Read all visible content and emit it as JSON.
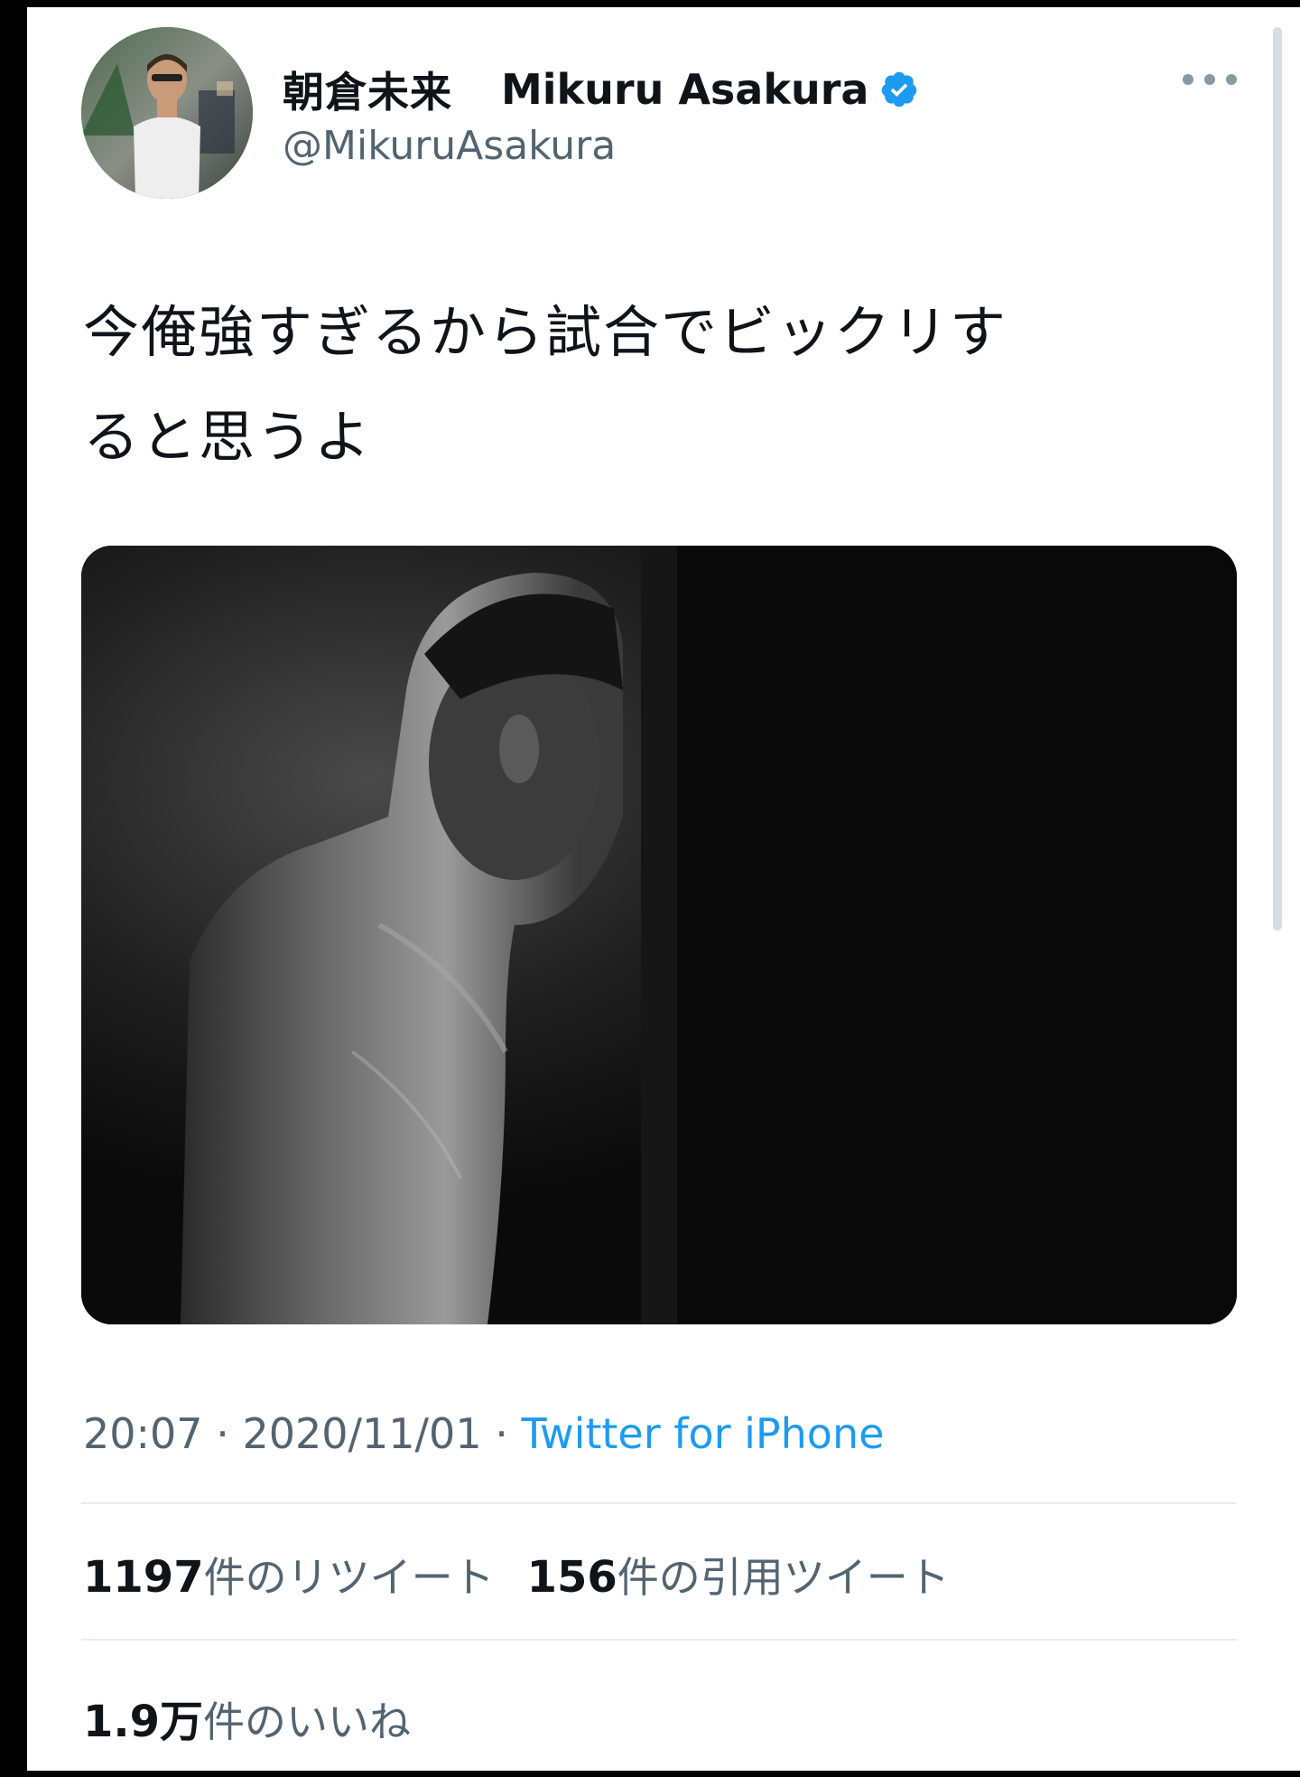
{
  "profile": {
    "display_name_jp": "朝倉未来",
    "display_name_en": "Mikuru Asakura",
    "handle": "@MikuruAsakura",
    "verified_icon": "verified-badge-icon",
    "accent_color": "#1d9bf0"
  },
  "tweet": {
    "text_line1": "今俺強すぎるから試合でビックリす",
    "text_line2": "ると思うよ",
    "time": "20:07",
    "separator": "·",
    "date": "2020/11/01",
    "source": "Twitter for iPhone"
  },
  "stats": {
    "retweets_count": "1197",
    "retweets_label": "件のリツイート",
    "quotes_count": "156",
    "quotes_label": "件の引用ツイート",
    "likes_count": "1.9万",
    "likes_label": "件のいいね"
  },
  "icons": {
    "more": "more-options-icon"
  }
}
